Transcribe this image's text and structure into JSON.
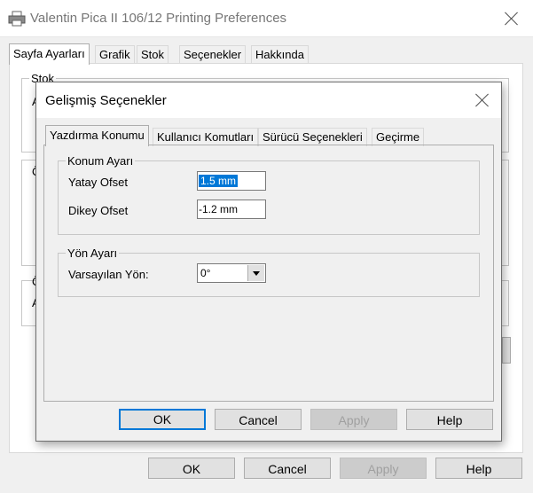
{
  "main_window": {
    "title": "Valentin Pica II 106/12 Printing Preferences",
    "tabs": [
      "Sayfa Ayarları",
      "Grafik",
      "Stok",
      "Seçenekler",
      "Hakkında"
    ],
    "group_stok": "Stok",
    "partial_letters": [
      "A",
      "Ö",
      "Ö",
      "A"
    ],
    "buttons": {
      "ok": "OK",
      "cancel": "Cancel",
      "apply": "Apply",
      "help": "Help"
    }
  },
  "dialog": {
    "title": "Gelişmiş Seçenekler",
    "tabs": [
      "Yazdırma Konumu",
      "Kullanıcı Komutları",
      "Sürücü Seçenekleri",
      "Geçirme"
    ],
    "position_group": {
      "title": "Konum Ayarı",
      "horizontal_label": "Yatay Ofset",
      "horizontal_value": "1.5 mm",
      "vertical_label": "Dikey Ofset",
      "vertical_value": "-1.2 mm"
    },
    "orientation_group": {
      "title": "Yön Ayarı",
      "default_label": "Varsayılan Yön:",
      "default_value": "0°"
    },
    "buttons": {
      "ok": "OK",
      "cancel": "Cancel",
      "apply": "Apply",
      "help": "Help"
    }
  },
  "icons": [
    "printer-icon",
    "close-icon",
    "chevron-down-icon"
  ],
  "colors": {
    "accent": "#0078d7",
    "background": "#f0f0f0",
    "disabled_text": "#a0a0a0"
  }
}
